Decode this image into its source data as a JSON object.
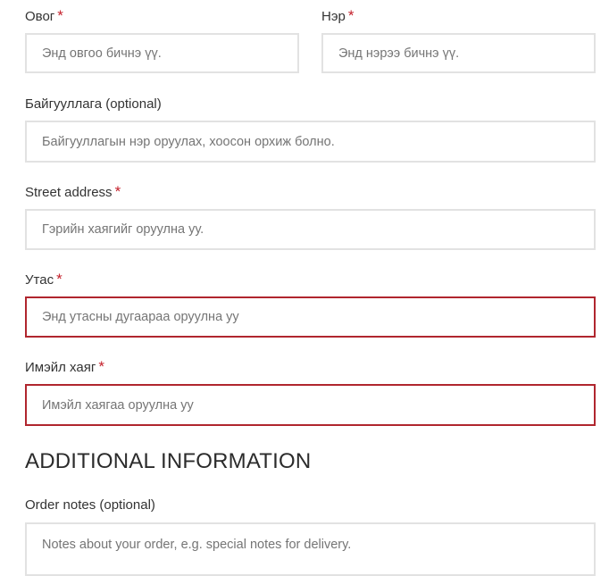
{
  "billing": {
    "last_name": {
      "label": "Овог",
      "required_mark": "*",
      "placeholder": "Энд овгоо бичнэ үү.",
      "value": ""
    },
    "first_name": {
      "label": "Нэр",
      "required_mark": "*",
      "placeholder": "Энд нэрээ бичнэ үү.",
      "value": ""
    },
    "company": {
      "label": "Байгууллага (optional)",
      "placeholder": "Байгууллагын нэр оруулах, хоосон орхиж болно.",
      "value": ""
    },
    "street_address": {
      "label": "Street address",
      "required_mark": "*",
      "placeholder": "Гэрийн хаягийг оруулна уу.",
      "value": ""
    },
    "phone": {
      "label": "Утас",
      "required_mark": "*",
      "placeholder": "Энд утасны дугаараа оруулна уу",
      "value": "",
      "state": "error"
    },
    "email": {
      "label": "Имэйл хаяг",
      "required_mark": "*",
      "placeholder": "Имэйл хаягаа оруулна уу",
      "value": "",
      "state": "error"
    }
  },
  "additional": {
    "title": "ADDITIONAL INFORMATION",
    "order_notes": {
      "label": "Order notes (optional)",
      "placeholder": "Notes about your order, e.g. special notes for delivery.",
      "value": ""
    }
  },
  "colors": {
    "required_star": "#c4202b",
    "error_border": "#b0262e",
    "field_border": "#e2e2e2",
    "text": "#333333"
  }
}
